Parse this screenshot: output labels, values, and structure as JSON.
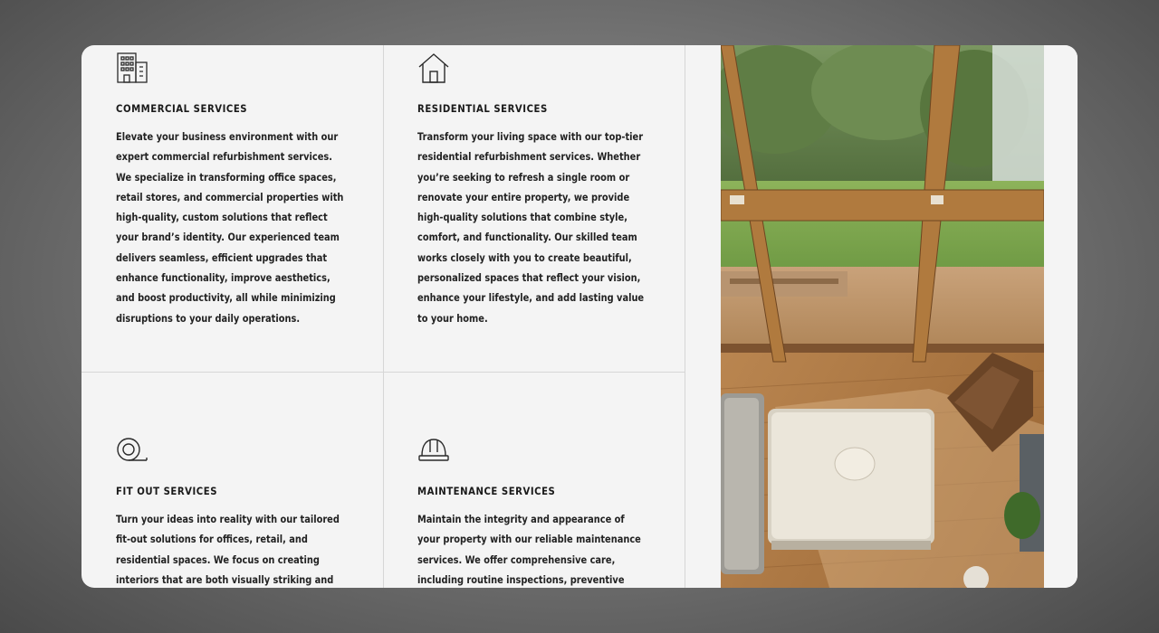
{
  "services": [
    {
      "icon": "building-icon",
      "title": "COMMERCIAL SERVICES",
      "description": "Elevate your business environment with our expert commercial refurbishment services. We specialize in transforming office spaces, retail stores, and commercial properties with high-quality, custom solutions that reflect your brand’s identity. Our experienced team delivers seamless, efficient upgrades that enhance functionality, improve aesthetics, and boost productivity, all while minimizing disruptions to your daily operations."
    },
    {
      "icon": "house-icon",
      "title": "RESIDENTIAL SERVICES",
      "description": "Transform your living space with our top-tier residential refurbishment services. Whether you’re seeking to refresh a single room or renovate your entire property, we provide high-quality solutions that combine style, comfort, and functionality. Our skilled team works closely with you to create beautiful, personalized spaces that reflect your vision, enhance your lifestyle, and add lasting value to your home."
    },
    {
      "icon": "tape-measure-icon",
      "title": "FIT OUT SERVICES",
      "description": "Turn your ideas into reality with our tailored fit-out solutions for offices, retail, and residential spaces. We focus on creating interiors that are both visually striking and highly functional, designed to meet your"
    },
    {
      "icon": "hard-hat-icon",
      "title": "MAINTENANCE SERVICES",
      "description": "Maintain the integrity and appearance of your property with our reliable maintenance services. We offer comprehensive care, including routine inspections, preventive measures, and emergency"
    }
  ],
  "colors": {
    "card_background": "#f4f4f4",
    "text": "#1a1a1a",
    "divider": "#d6d6d6"
  }
}
